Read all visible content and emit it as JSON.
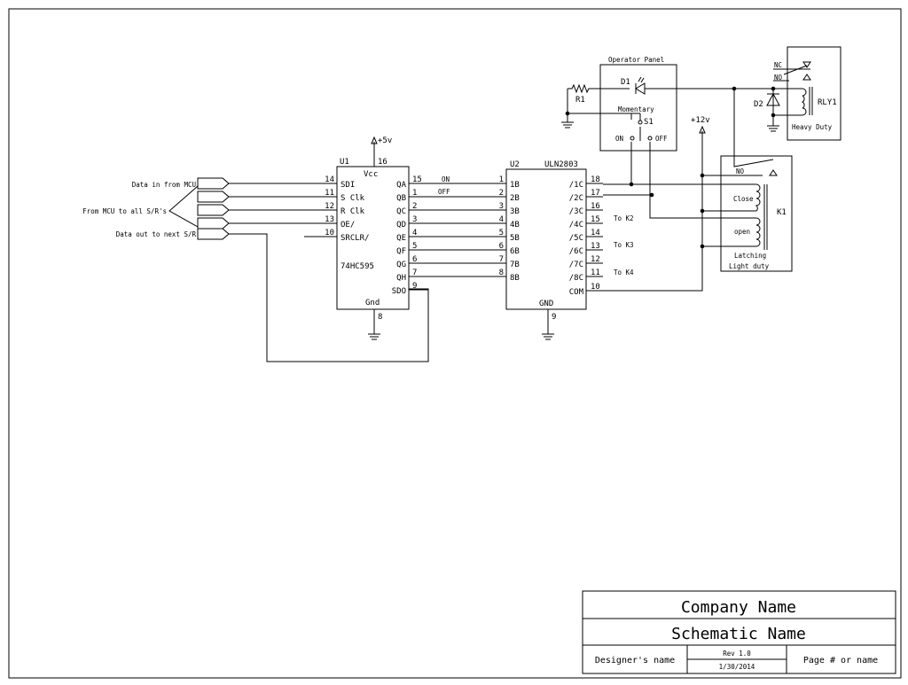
{
  "u1": {
    "ref": "U1",
    "part": "74HC595",
    "vcc_label": "Vcc",
    "vcc_pin": "16",
    "supply": "+5v",
    "gnd_label": "Gnd",
    "gnd_pin": "8",
    "left_pins": [
      {
        "num": "14",
        "name": "SDI"
      },
      {
        "num": "11",
        "name": "S Clk"
      },
      {
        "num": "12",
        "name": "R Clk"
      },
      {
        "num": "13",
        "name": "OE/"
      },
      {
        "num": "10",
        "name": "SRCLR/"
      }
    ],
    "right_pins": [
      {
        "num": "15",
        "name": "QA"
      },
      {
        "num": "1",
        "name": "QB"
      },
      {
        "num": "2",
        "name": "QC"
      },
      {
        "num": "3",
        "name": "QD"
      },
      {
        "num": "4",
        "name": "QE"
      },
      {
        "num": "5",
        "name": "QF"
      },
      {
        "num": "6",
        "name": "QG"
      },
      {
        "num": "7",
        "name": "QH"
      },
      {
        "num": "9",
        "name": "SDO"
      }
    ]
  },
  "u2": {
    "ref": "U2",
    "part": "ULN2803",
    "gnd_label": "GND",
    "gnd_pin": "9",
    "left_pins": [
      {
        "num": "1",
        "name": "1B"
      },
      {
        "num": "2",
        "name": "2B"
      },
      {
        "num": "3",
        "name": "3B"
      },
      {
        "num": "4",
        "name": "4B"
      },
      {
        "num": "5",
        "name": "5B"
      },
      {
        "num": "6",
        "name": "6B"
      },
      {
        "num": "7",
        "name": "7B"
      },
      {
        "num": "8",
        "name": "8B"
      }
    ],
    "right_pins": [
      {
        "num": "18",
        "name": "/1C"
      },
      {
        "num": "17",
        "name": "/2C"
      },
      {
        "num": "16",
        "name": "/3C"
      },
      {
        "num": "15",
        "name": "/4C"
      },
      {
        "num": "14",
        "name": "/5C"
      },
      {
        "num": "13",
        "name": "/6C"
      },
      {
        "num": "12",
        "name": "/7C"
      },
      {
        "num": "11",
        "name": "/8C"
      },
      {
        "num": "10",
        "name": "COM"
      }
    ]
  },
  "connectors": {
    "data_in": "Data in from MCU",
    "from_mcu": "From MCU to all S/R's",
    "data_out": "Data out to next S/R"
  },
  "net_labels": {
    "on": "ON",
    "off": "OFF",
    "to_k2": "To K2",
    "to_k3": "To K3",
    "to_k4": "To K4",
    "v12": "+12v"
  },
  "operator_panel": {
    "title": "Operator Panel",
    "r1": "R1",
    "d1": "D1",
    "switch_type": "Momentary",
    "s1": "S1",
    "on": "ON",
    "off": "OFF"
  },
  "k1": {
    "ref": "K1",
    "no": "NO",
    "close": "Close",
    "open": "open",
    "desc1": "Latching",
    "desc2": "Light duty"
  },
  "rly1": {
    "ref": "RLY1",
    "nc": "NC",
    "no": "NO",
    "d2": "D2",
    "desc": "Heavy Duty"
  },
  "title_block": {
    "company": "Company Name",
    "schematic": "Schematic Name",
    "designer": "Designer's name",
    "rev": "Rev 1.0",
    "date": "1/30/2014",
    "page": "Page # or name"
  }
}
